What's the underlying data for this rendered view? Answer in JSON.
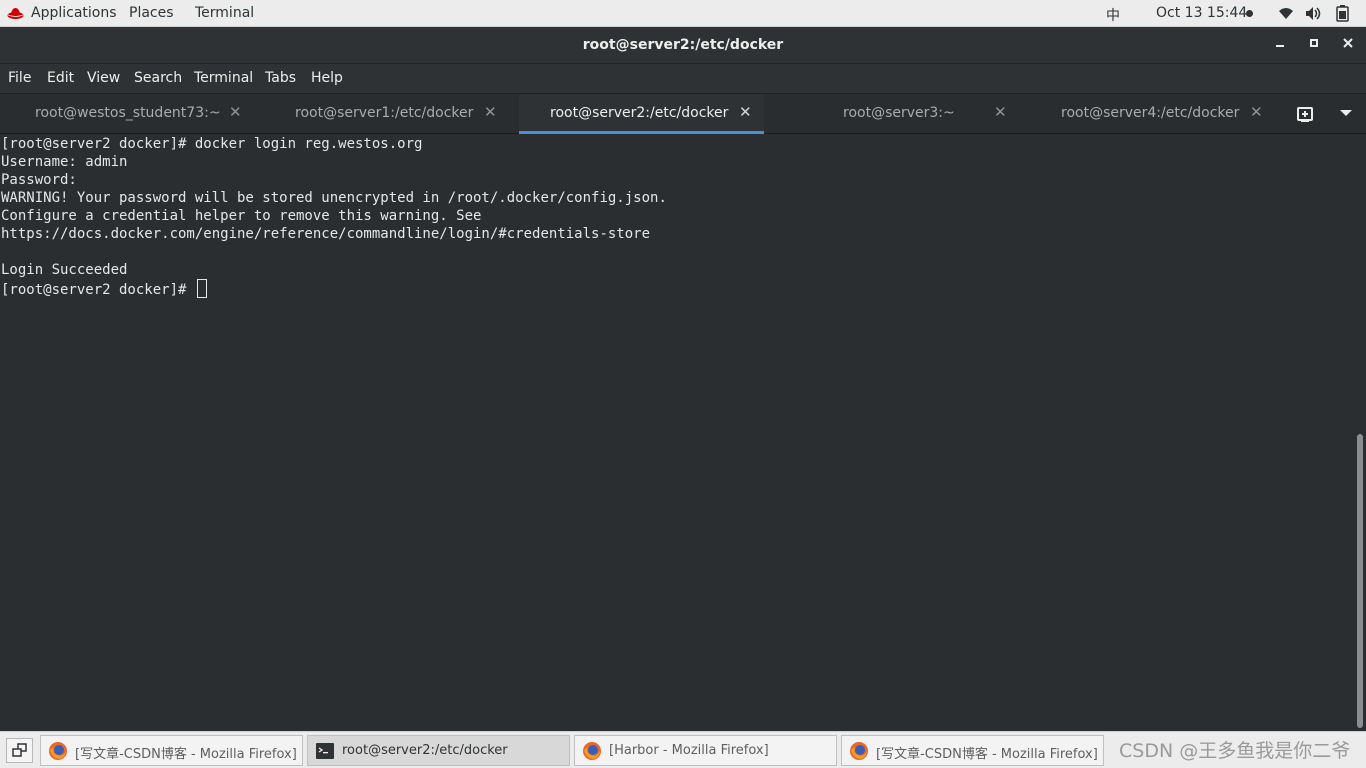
{
  "system_bar": {
    "applications": "Applications",
    "places": "Places",
    "terminal": "Terminal",
    "ime": "中",
    "clock": "Oct 13  15:44"
  },
  "window": {
    "title": "root@server2:/etc/docker"
  },
  "menu": [
    "File",
    "Edit",
    "View",
    "Search",
    "Terminal",
    "Tabs",
    "Help"
  ],
  "tabs": [
    {
      "label": "root@westos_student73:~",
      "active": false
    },
    {
      "label": "root@server1:/etc/docker",
      "active": false
    },
    {
      "label": "root@server2:/etc/docker",
      "active": true
    },
    {
      "label": "root@server3:~",
      "active": false
    },
    {
      "label": "root@server4:/etc/docker",
      "active": false
    }
  ],
  "terminal": {
    "lines": [
      "[root@server2 docker]# docker login reg.westos.org",
      "Username: admin",
      "Password:",
      "WARNING! Your password will be stored unencrypted in /root/.docker/config.json.",
      "Configure a credential helper to remove this warning. See",
      "https://docs.docker.com/engine/reference/commandline/login/#credentials-store",
      "",
      "Login Succeeded",
      "[root@server2 docker]# "
    ]
  },
  "taskbar": {
    "tasks": [
      {
        "label": "[写文章-CSDN博客 - Mozilla Firefox]",
        "icon": "firefox-icon",
        "active": false
      },
      {
        "label": "root@server2:/etc/docker",
        "icon": "terminal-icon",
        "active": true
      },
      {
        "label": "[Harbor - Mozilla Firefox]",
        "icon": "firefox-icon",
        "active": false
      },
      {
        "label": "[写文章-CSDN博客 - Mozilla Firefox]",
        "icon": "firefox-icon",
        "active": false
      }
    ],
    "watermark": "CSDN @王多鱼我是你二爷"
  },
  "colors": {
    "accent": "#4a90d9",
    "terminal_bg": "#2b2e30",
    "redhat": "#cc0000"
  }
}
